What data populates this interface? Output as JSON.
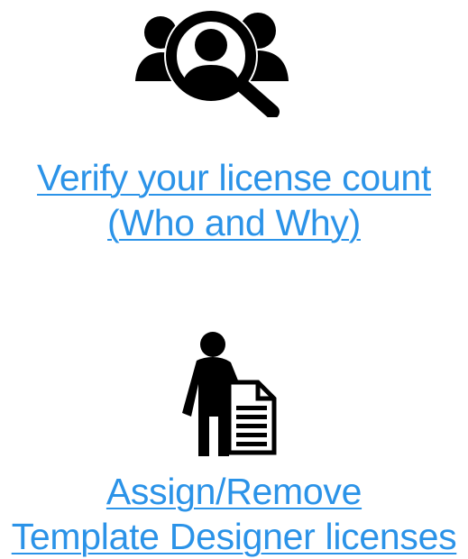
{
  "tiles": [
    {
      "icon": "user-search-icon",
      "link_lines": [
        "Verify your license count",
        "(Who and Why)"
      ]
    },
    {
      "icon": "person-document-icon",
      "link_lines": [
        "Assign/Remove",
        "Template Designer licenses"
      ]
    }
  ],
  "colors": {
    "link": "#2b93e8",
    "icon": "#000000"
  }
}
